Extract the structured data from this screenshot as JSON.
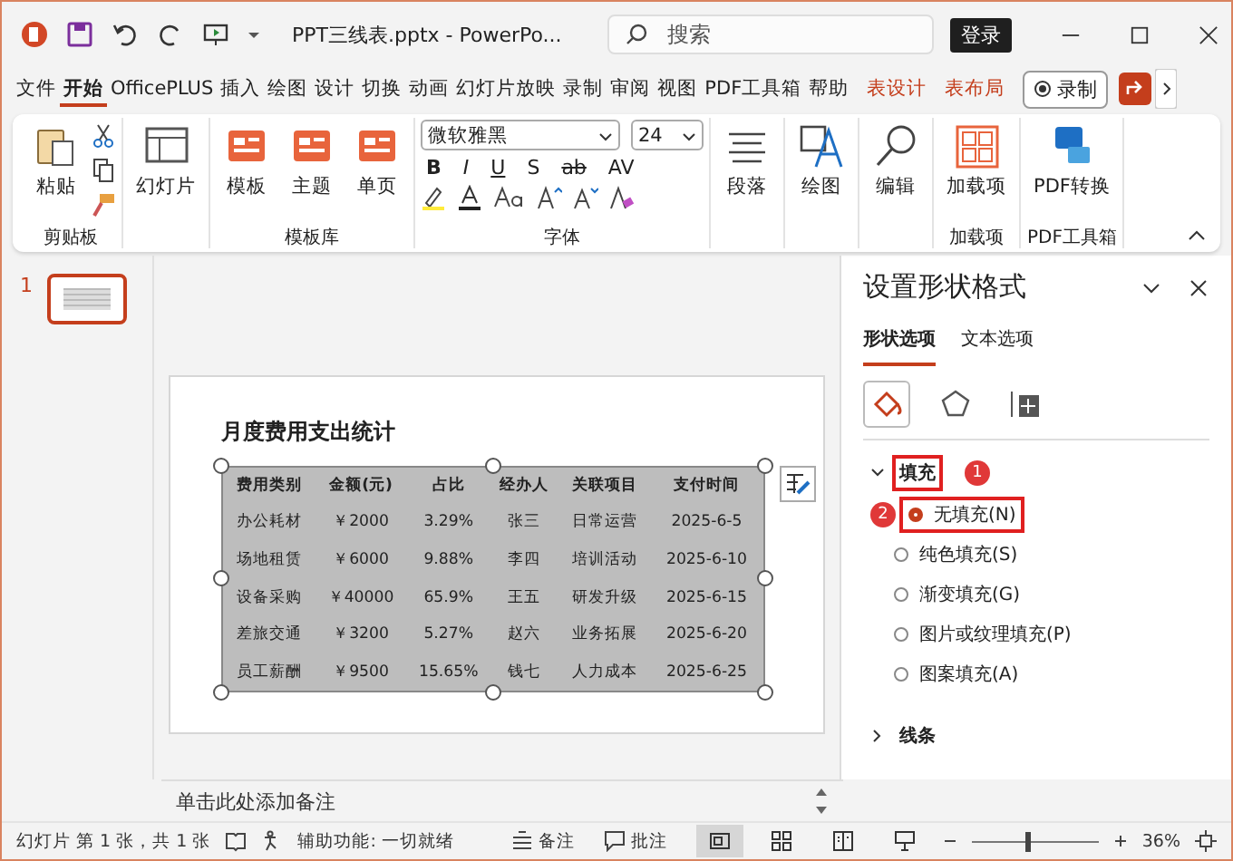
{
  "window": {
    "title": "PPT三线表.pptx  -  PowerPo...",
    "search_placeholder": "搜索",
    "login": "登录"
  },
  "tabs": [
    {
      "label": "文件",
      "selected": false,
      "kind": "normal"
    },
    {
      "label": "开始",
      "selected": true,
      "kind": "normal"
    },
    {
      "label": "OfficePLUS",
      "selected": false,
      "kind": "normal"
    },
    {
      "label": "插入",
      "selected": false,
      "kind": "normal"
    },
    {
      "label": "绘图",
      "selected": false,
      "kind": "normal"
    },
    {
      "label": "设计",
      "selected": false,
      "kind": "normal"
    },
    {
      "label": "切换",
      "selected": false,
      "kind": "normal"
    },
    {
      "label": "动画",
      "selected": false,
      "kind": "normal"
    },
    {
      "label": "幻灯片放映",
      "selected": false,
      "kind": "normal"
    },
    {
      "label": "录制",
      "selected": false,
      "kind": "normal"
    },
    {
      "label": "审阅",
      "selected": false,
      "kind": "normal"
    },
    {
      "label": "视图",
      "selected": false,
      "kind": "normal"
    },
    {
      "label": "PDF工具箱",
      "selected": false,
      "kind": "normal"
    },
    {
      "label": "帮助",
      "selected": false,
      "kind": "normal"
    },
    {
      "label": "表设计",
      "selected": false,
      "kind": "contextual"
    },
    {
      "label": "表布局",
      "selected": false,
      "kind": "contextual"
    }
  ],
  "record_button": "录制",
  "ribbon": {
    "paste": "粘贴",
    "clipboard_label": "剪贴板",
    "slides": "幻灯片",
    "templates": [
      "模板",
      "主题",
      "单页"
    ],
    "templates_label": "模板库",
    "font_name": "微软雅黑",
    "font_size": "24",
    "format_letters": [
      "B",
      "I",
      "U",
      "S",
      "ab",
      "AV"
    ],
    "font_label": "字体",
    "paragraph": "段落",
    "draw": "绘图",
    "edit": "编辑",
    "addins": "加载项",
    "addins_label": "加载项",
    "pdf": "PDF转换",
    "pdf_label": "PDF工具箱"
  },
  "thumbnail_number": "1",
  "slide": {
    "title": "月度费用支出统计",
    "table": {
      "columns": [
        "费用类别",
        "金额(元)",
        "占比",
        "经办人",
        "关联项目",
        "支付时间"
      ],
      "rows": [
        [
          "办公耗材",
          "￥2000",
          "3.29%",
          "张三",
          "日常运营",
          "2025-6-5"
        ],
        [
          "场地租赁",
          "￥6000",
          "9.88%",
          "李四",
          "培训活动",
          "2025-6-10"
        ],
        [
          "设备采购",
          "￥40000",
          "65.9%",
          "王五",
          "研发升级",
          "2025-6-15"
        ],
        [
          "差旅交通",
          "￥3200",
          "5.27%",
          "赵六",
          "业务拓展",
          "2025-6-20"
        ],
        [
          "员工薪酬",
          "￥9500",
          "15.65%",
          "钱七",
          "人力成本",
          "2025-6-25"
        ]
      ]
    }
  },
  "pane": {
    "title": "设置形状格式",
    "subtabs": [
      {
        "label": "形状选项",
        "selected": true
      },
      {
        "label": "文本选项",
        "selected": false
      }
    ],
    "icon_tabs": [
      {
        "kind": "fill",
        "selected": true
      },
      {
        "kind": "effects",
        "selected": false
      },
      {
        "kind": "size",
        "selected": false
      }
    ],
    "sections": [
      {
        "label": "填充",
        "expanded": true,
        "highlighted": true,
        "badge": "1",
        "options": [
          {
            "label": "无填充(N)",
            "selected": true,
            "highlighted": true,
            "badge": "2"
          },
          {
            "label": "纯色填充(S)",
            "selected": false,
            "highlighted": false
          },
          {
            "label": "渐变填充(G)",
            "selected": false,
            "highlighted": false
          },
          {
            "label": "图片或纹理填充(P)",
            "selected": false,
            "highlighted": false
          },
          {
            "label": "图案填充(A)",
            "selected": false,
            "highlighted": false
          }
        ]
      },
      {
        "label": "线条",
        "expanded": false,
        "highlighted": false
      }
    ]
  },
  "notes_placeholder": "单击此处添加备注",
  "status_bar": {
    "slide_info": "幻灯片 第 1 张，共 1 张",
    "accessibility": "辅助功能: 一切就绪",
    "notes": "备注",
    "comments": "批注",
    "views": [
      {
        "kind": "normal",
        "selected": true
      },
      {
        "kind": "sorter",
        "selected": false
      },
      {
        "kind": "reading",
        "selected": false
      },
      {
        "kind": "show",
        "selected": false
      }
    ],
    "zoom": {
      "level": 0.45,
      "reading": "36%"
    }
  }
}
